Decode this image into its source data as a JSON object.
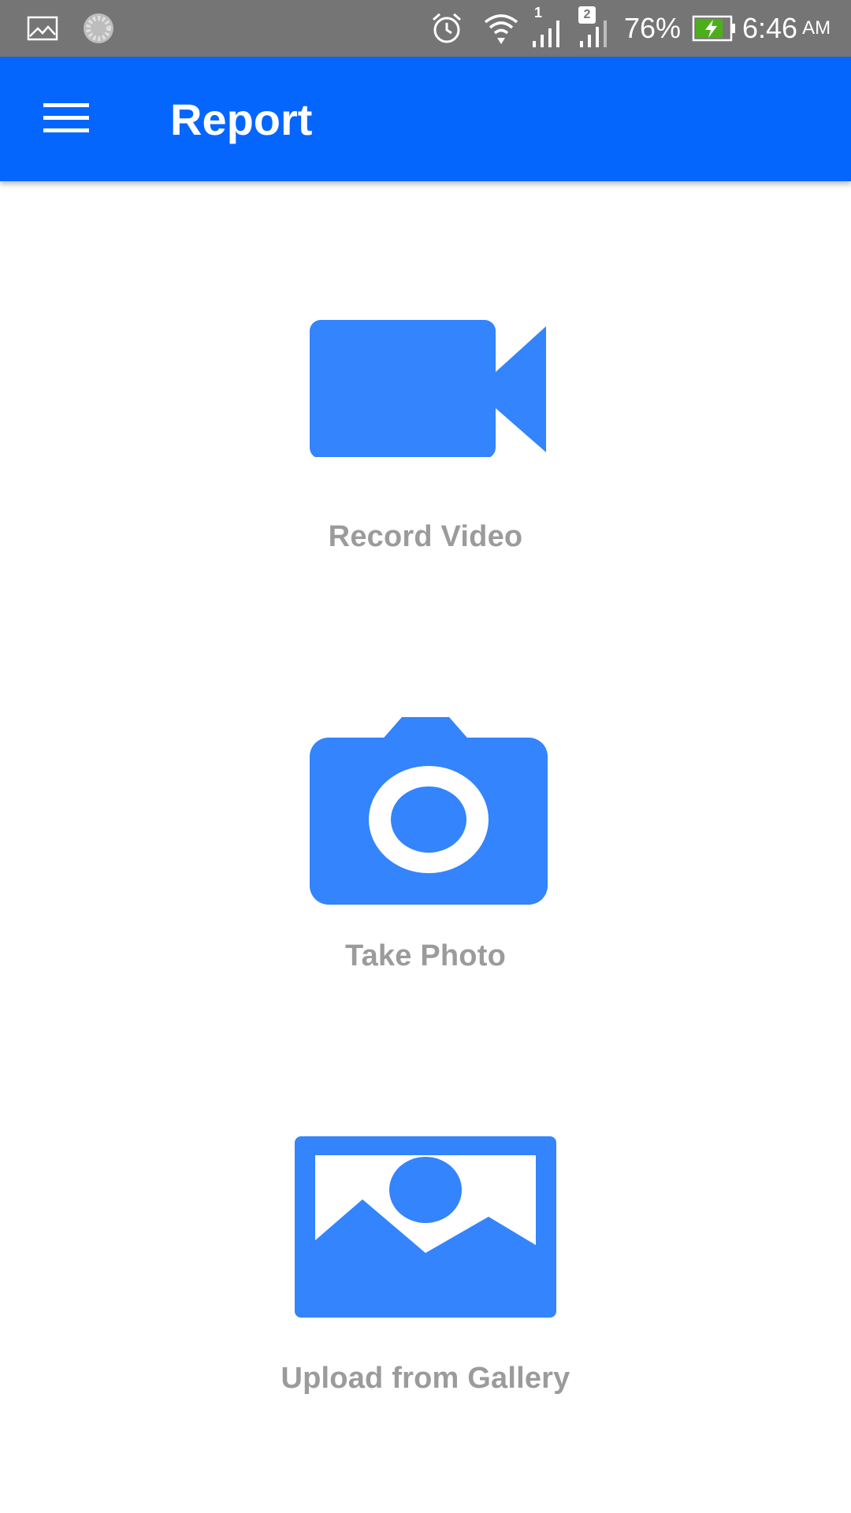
{
  "status_bar": {
    "battery_percent": "76%",
    "time": "6:46",
    "ampm": "AM",
    "sim1_label": "1",
    "sim2_label": "2",
    "icons": [
      "gallery-notification-icon",
      "loading-spinner-icon",
      "alarm-icon",
      "wifi-icon",
      "signal-sim1-icon",
      "signal-sim2-icon",
      "battery-charging-icon"
    ]
  },
  "app_bar": {
    "title": "Report",
    "menu_icon": "hamburger-menu-icon",
    "background_color": "#0566fe"
  },
  "actions": [
    {
      "label": "Record Video",
      "icon": "video-camera-icon"
    },
    {
      "label": "Take Photo",
      "icon": "photo-camera-icon"
    },
    {
      "label": "Upload from Gallery",
      "icon": "gallery-image-icon"
    }
  ],
  "colors": {
    "accent_icon": "#3384fd",
    "label_gray": "#9b9b9b",
    "status_bar": "#757575",
    "battery_fill": "#4caf1a"
  }
}
